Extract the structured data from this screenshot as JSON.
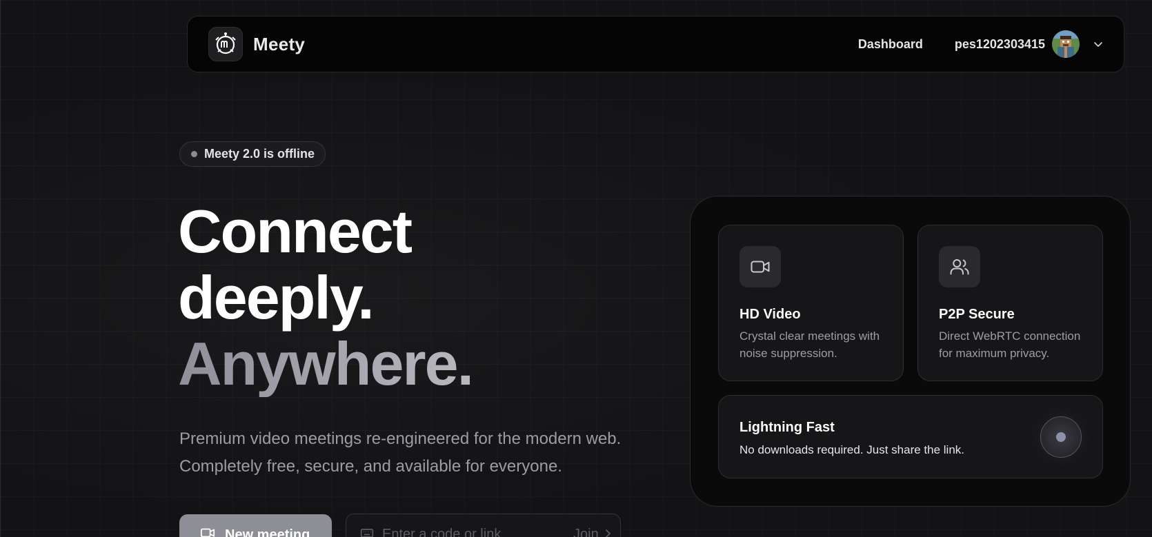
{
  "nav": {
    "brand": "Meety",
    "dashboard_link": "Dashboard",
    "username": "pes1202303415"
  },
  "hero": {
    "badge": "Meety 2.0 is offline",
    "headline_line1": "Connect",
    "headline_line2": "deeply.",
    "headline_line3": "Anywhere.",
    "subtitle_line1": "Premium video meetings re-engineered for the modern web.",
    "subtitle_line2": "Completely free, secure, and available for everyone.",
    "new_meeting_label": "New meeting",
    "join_placeholder": "Enter a code or link",
    "join_label": "Join"
  },
  "features": [
    {
      "icon": "video-camera-icon",
      "title": "HD Video",
      "desc": "Crystal clear meetings with noise suppression."
    },
    {
      "icon": "users-icon",
      "title": "P2P Secure",
      "desc": "Direct WebRTC connection for maximum privacy."
    },
    {
      "icon": "pulse-indicator",
      "title": "Lightning Fast",
      "desc": "No downloads required. Just share the link."
    }
  ],
  "colors": {
    "background": "#131315",
    "navbar": "#050506",
    "accent_button": "#8e8e97",
    "muted_text": "#9c9ca5"
  }
}
